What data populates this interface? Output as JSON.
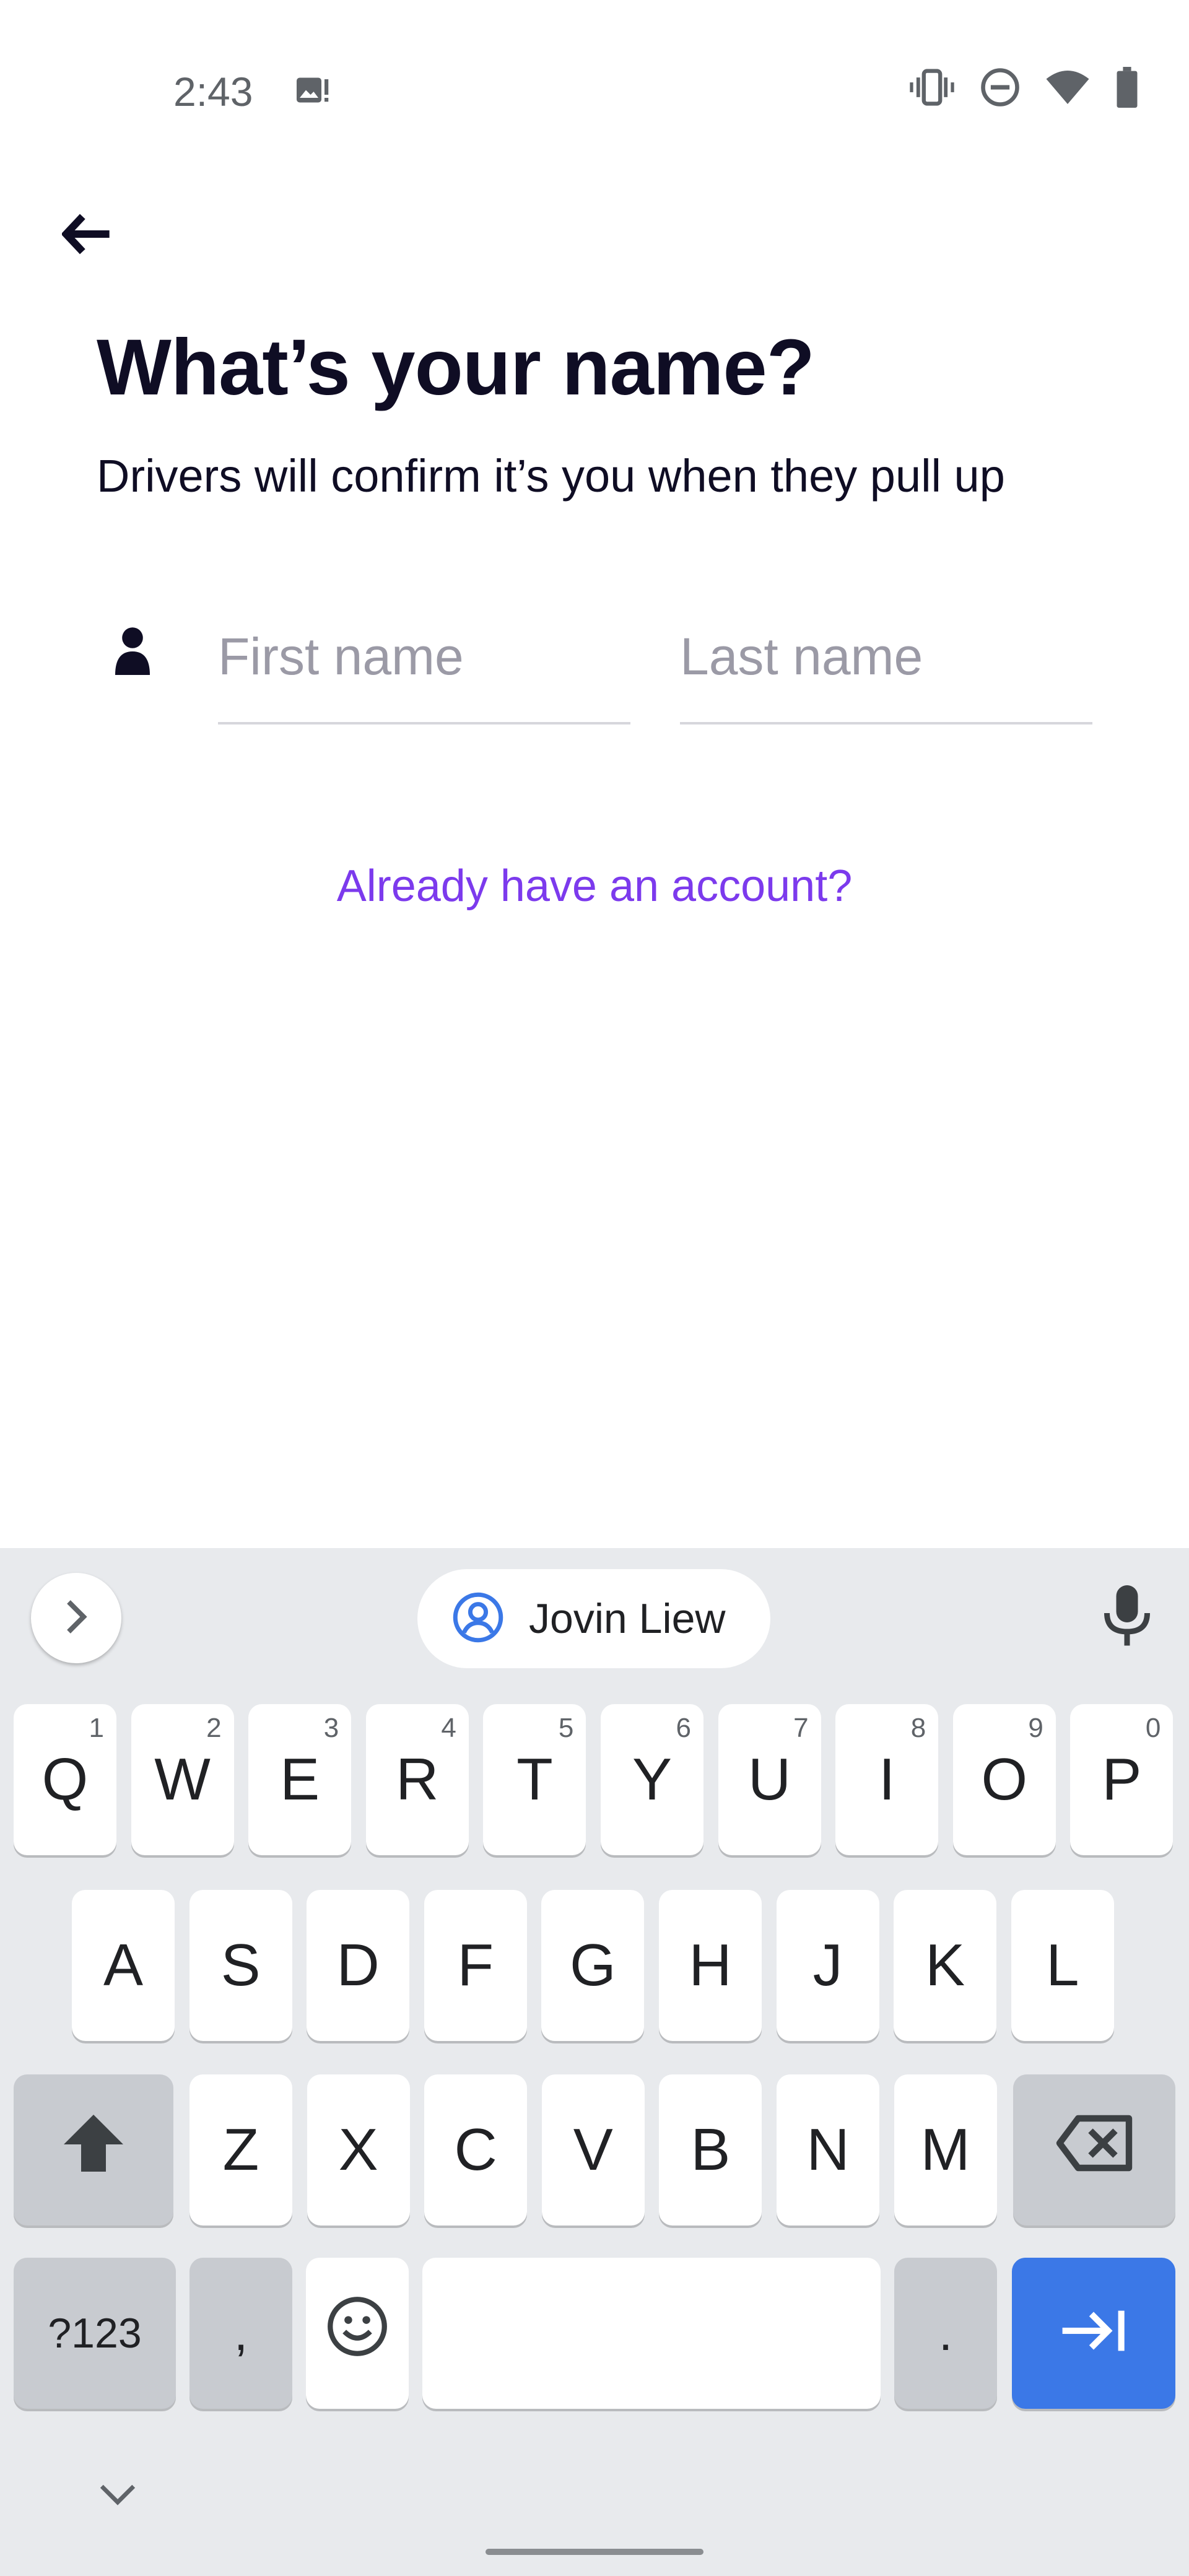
{
  "status_bar": {
    "time": "2:43",
    "icons": [
      "image-alert-icon",
      "vibrate-icon",
      "do-not-disturb-icon",
      "wifi-icon",
      "battery-icon"
    ]
  },
  "header": {
    "back_icon": "arrow-left-icon",
    "title": "What’s your name?",
    "subtitle": "Drivers will confirm it’s you when they pull up"
  },
  "form": {
    "person_icon": "person-icon",
    "first_name": {
      "value": "",
      "placeholder": "First name"
    },
    "last_name": {
      "value": "",
      "placeholder": "Last name"
    }
  },
  "links": {
    "account": "Already have an account?"
  },
  "keyboard": {
    "suggestion": "Jovin Liew",
    "row1": [
      {
        "label": "Q",
        "hint": "1"
      },
      {
        "label": "W",
        "hint": "2"
      },
      {
        "label": "E",
        "hint": "3"
      },
      {
        "label": "R",
        "hint": "4"
      },
      {
        "label": "T",
        "hint": "5"
      },
      {
        "label": "Y",
        "hint": "6"
      },
      {
        "label": "U",
        "hint": "7"
      },
      {
        "label": "I",
        "hint": "8"
      },
      {
        "label": "O",
        "hint": "9"
      },
      {
        "label": "P",
        "hint": "0"
      }
    ],
    "row2": [
      "A",
      "S",
      "D",
      "F",
      "G",
      "H",
      "J",
      "K",
      "L"
    ],
    "row3": [
      "Z",
      "X",
      "C",
      "V",
      "B",
      "N",
      "M"
    ],
    "symbols_label": "?123",
    "comma_label": ",",
    "period_label": ".",
    "accent_color": "#3b78e7"
  },
  "colors": {
    "title": "#0f0d24",
    "link": "#7c3aed",
    "placeholder": "#9b9aa6"
  }
}
